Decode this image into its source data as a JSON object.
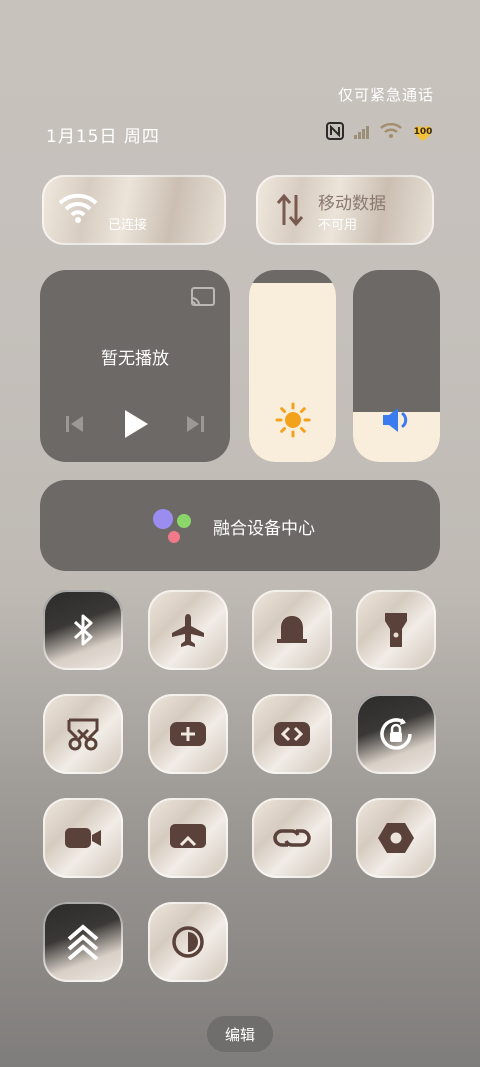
{
  "status": {
    "emergency_text": "仅可紧急通话",
    "date": "1月15日 周四",
    "battery": "100"
  },
  "wifi_tile": {
    "label": "已连接"
  },
  "data_tile": {
    "title": "移动数据",
    "subtitle": "不可用"
  },
  "media": {
    "title": "暂无播放"
  },
  "brightness": {
    "level": 0.93
  },
  "volume": {
    "level": 0.26
  },
  "fusion": {
    "label": "融合设备中心"
  },
  "toggles": [
    {
      "name": "bluetooth",
      "icon": "bluetooth-icon"
    },
    {
      "name": "airplane-mode",
      "icon": "airplane-icon"
    },
    {
      "name": "do-not-disturb",
      "icon": "bell-icon"
    },
    {
      "name": "flashlight",
      "icon": "flashlight-icon"
    },
    {
      "name": "screenshot",
      "icon": "scissors-icon"
    },
    {
      "name": "screen-record",
      "icon": "add-icon"
    },
    {
      "name": "share",
      "icon": "share-icon"
    },
    {
      "name": "auto-rotate",
      "icon": "rotate-lock-icon"
    },
    {
      "name": "camera",
      "icon": "video-icon"
    },
    {
      "name": "projection",
      "icon": "screen-icon"
    },
    {
      "name": "nfc",
      "icon": "link-icon"
    },
    {
      "name": "settings",
      "icon": "gear-icon"
    },
    {
      "name": "performance",
      "icon": "chevrons-up-icon"
    },
    {
      "name": "dark-mode",
      "icon": "contrast-icon"
    }
  ],
  "edit": {
    "label": "编辑"
  },
  "colors": {
    "sun": "#f3a21c",
    "speaker": "#3a7bf0",
    "slider_fill": "#f9eedb",
    "panel": "#6c6966"
  }
}
